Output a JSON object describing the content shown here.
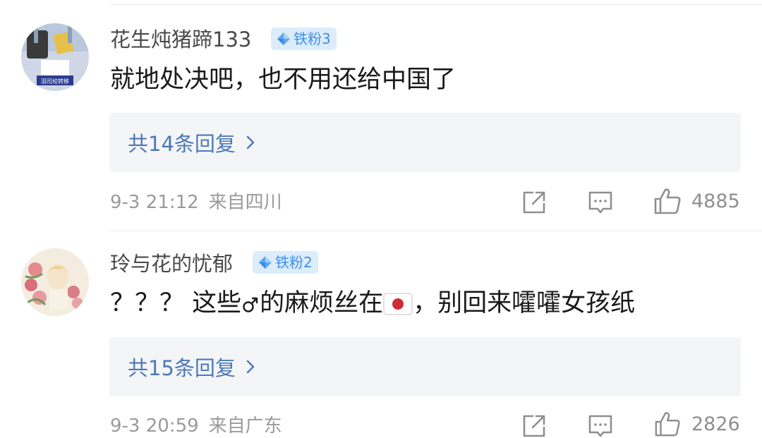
{
  "comments": [
    {
      "username": "花生炖猪蹄133",
      "badge": "铁粉3",
      "content_parts": [
        "就地处决吧，也不用还给中国了"
      ],
      "reply_label": "共14条回复",
      "time": "9-3 21:12",
      "location": "来自四川",
      "likes": "4885",
      "avatar_banner_text": "羽司校转移"
    },
    {
      "username": "玲与花的忧郁",
      "badge": "铁粉2",
      "content_before": "？？？ 这些",
      "content_mid": "的麻烦丝在",
      "content_after": "，别回来嚯嚯女孩纸",
      "reply_label": "共15条回复",
      "time": "9-3 20:59",
      "location": "来自广东",
      "likes": "2826"
    }
  ],
  "icons": {
    "badge": "diamond-icon",
    "reply_chevron": "chevron-right-icon",
    "share": "share-icon",
    "comment": "comment-icon",
    "like": "thumbs-up-icon",
    "male_symbol": "male-symbol-icon",
    "flag": "japan-flag-icon"
  },
  "colors": {
    "badge_bg": "#dcecfb",
    "badge_text": "#3f8fe8",
    "reply_link": "#4c79b8",
    "meta_text": "#9a9a9a"
  }
}
